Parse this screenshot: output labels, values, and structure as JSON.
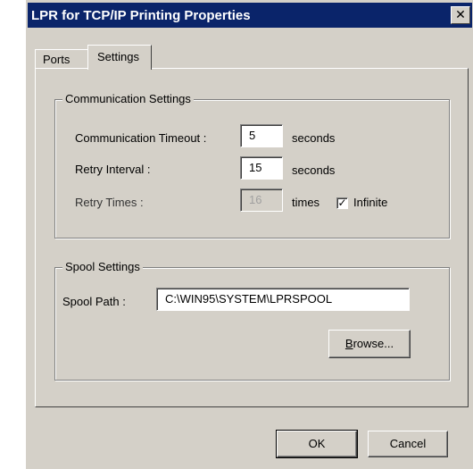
{
  "window": {
    "title": "LPR for TCP/IP Printing Properties",
    "close_glyph": "✕"
  },
  "tabs": [
    {
      "label": "Ports",
      "selected": false
    },
    {
      "label": "Settings",
      "selected": true
    }
  ],
  "communication": {
    "group_label": "Communication Settings",
    "timeout_label": "Communication Timeout :",
    "timeout_value": "5",
    "timeout_unit": "seconds",
    "retry_interval_label": "Retry Interval :",
    "retry_interval_value": "15",
    "retry_interval_unit": "seconds",
    "retry_times_label": "Retry Times :",
    "retry_times_value": "16",
    "retry_times_unit": "times",
    "infinite_label": "Infinite",
    "infinite_checked": true,
    "check_glyph": "✓"
  },
  "spool": {
    "group_label": "Spool Settings",
    "path_label": "Spool Path :",
    "path_value": "C:\\WIN95\\SYSTEM\\LPRSPOOL",
    "browse_mnemonic": "B",
    "browse_rest": "rowse..."
  },
  "footer": {
    "ok_label": "OK",
    "cancel_label": "Cancel"
  }
}
